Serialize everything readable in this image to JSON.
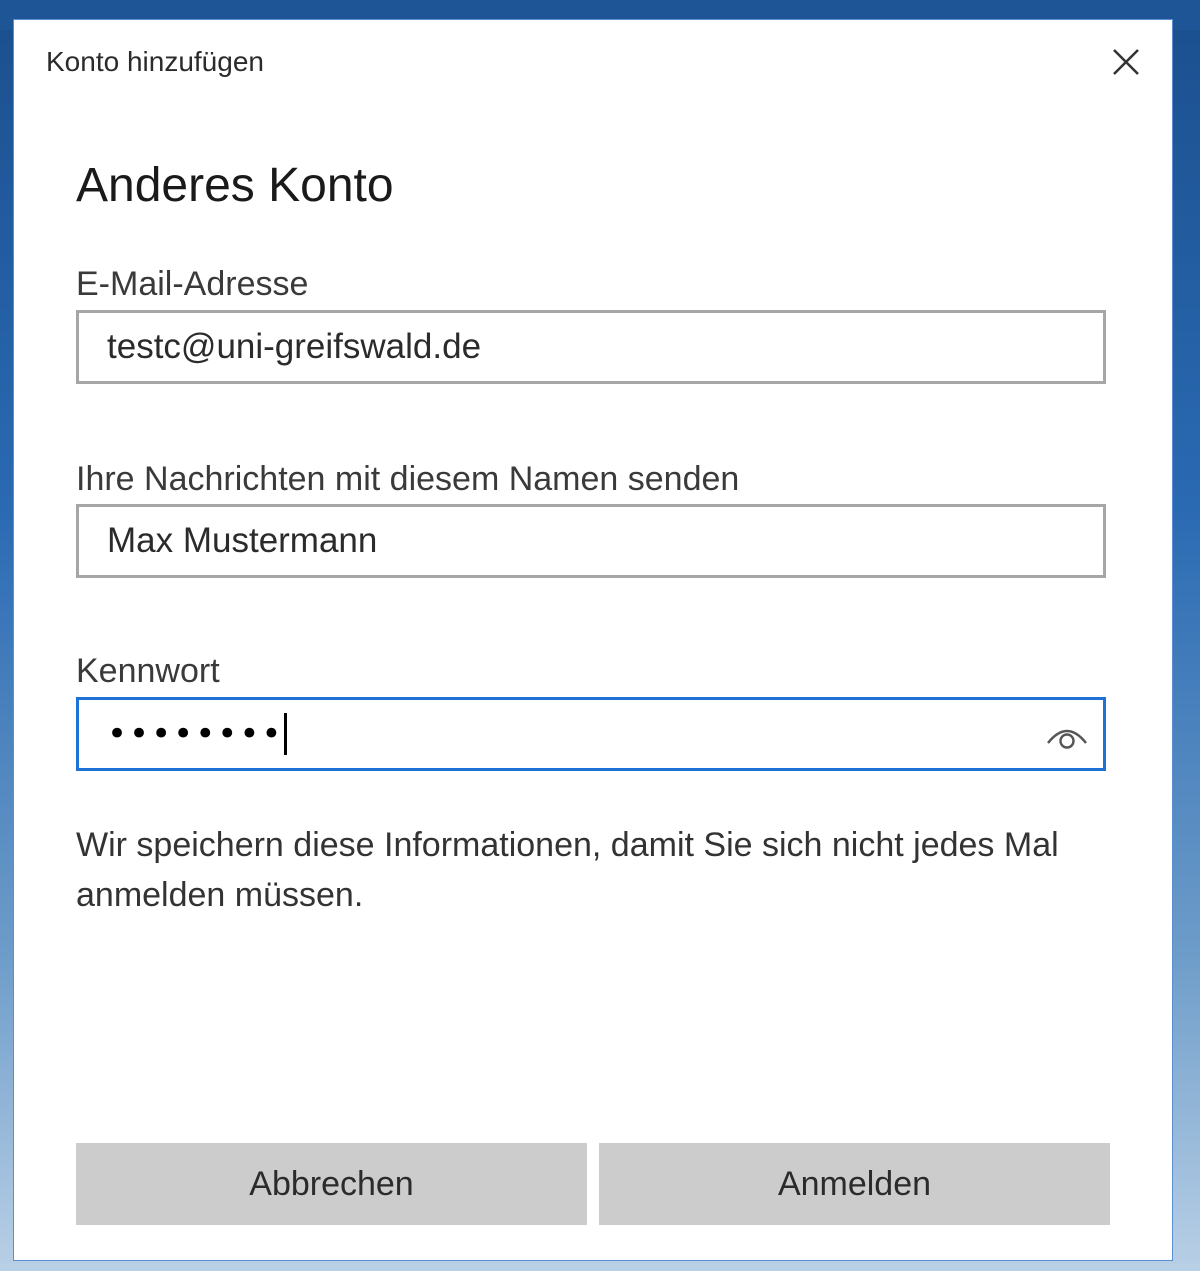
{
  "dialog": {
    "title": "Konto hinzufügen",
    "close_icon": "close-icon",
    "heading": "Anderes Konto"
  },
  "form": {
    "email": {
      "label": "E-Mail-Adresse",
      "value": "testc@uni-greifswald.de"
    },
    "name": {
      "label": "Ihre Nachrichten mit diesem Namen senden",
      "value": "Max Mustermann"
    },
    "password": {
      "label": "Kennwort",
      "masked_value": "••••••••",
      "reveal_icon": "eye-icon"
    },
    "info_text": "Wir speichern diese Informationen, damit Sie sich nicht jedes Mal anmelden müssen."
  },
  "buttons": {
    "cancel_label": "Abbrechen",
    "signin_label": "Anmelden"
  },
  "colors": {
    "focus_border": "#1e72d6",
    "button_bg": "#cccccc",
    "field_border": "#a6a6a6"
  }
}
